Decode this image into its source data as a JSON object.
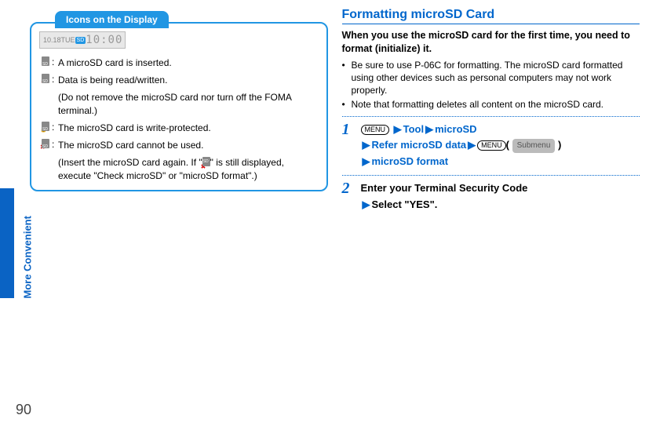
{
  "side_tab": "More Convenient",
  "page_num": "90",
  "left": {
    "box_title": "Icons on the Display",
    "status_date": "10.18TUE",
    "status_clock": "10:00",
    "rows": [
      {
        "glyph": "sd",
        "desc": "A microSD card is inserted.",
        "sub": ""
      },
      {
        "glyph": "rw",
        "desc": "Data is being read/written.",
        "sub": "(Do not remove the microSD card nor turn off the FOMA terminal.)"
      },
      {
        "glyph": "lock",
        "desc": "The microSD card is write-protected.",
        "sub": ""
      },
      {
        "glyph": "x",
        "desc": "The microSD card cannot be used.",
        "sub": "(Insert the microSD card again. If \"\" is still displayed, execute \"Check microSD\" or \"microSD format\".)",
        "sub_pre": "(Insert the microSD card again. If \"",
        "sub_post": "\" is still displayed, execute \"Check microSD\" or \"microSD format\".)"
      }
    ]
  },
  "right": {
    "title": "Formatting microSD Card",
    "intro": "When you use the microSD card for the first time, you need to format (initialize) it.",
    "bullets": [
      "Be sure to use P-06C for formatting. The microSD card formatted using other devices such as personal computers may not work properly.",
      "Note that formatting deletes all content on the microSD card."
    ],
    "step1": {
      "menu": "MENU",
      "w1": "Tool",
      "w2": "microSD",
      "w3": "Refer microSD data",
      "submenu": "Submenu",
      "w4": "microSD format"
    },
    "step2": {
      "line1": "Enter your Terminal Security Code",
      "line2": "Select \"YES\"."
    }
  }
}
